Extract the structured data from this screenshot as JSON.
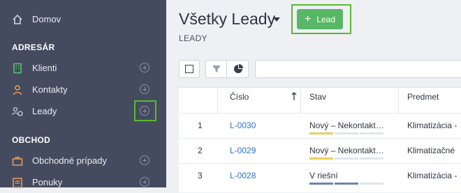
{
  "sidebar": {
    "home": {
      "label": "Domov",
      "icon": "home-icon"
    },
    "sections": [
      {
        "title": "ADRESÁR",
        "items": [
          {
            "label": "Klienti",
            "icon": "building-icon"
          },
          {
            "label": "Kontakty",
            "icon": "person-icon"
          },
          {
            "label": "Leady",
            "icon": "leads-icon"
          }
        ]
      },
      {
        "title": "OBCHOD",
        "items": [
          {
            "label": "Obchodné prípady",
            "icon": "briefcase-icon"
          },
          {
            "label": "Ponuky",
            "icon": "document-icon"
          }
        ]
      }
    ],
    "colors": {
      "background": "#444b5e",
      "highlight": "#5aba2d"
    }
  },
  "header": {
    "title": "Všetky Leady",
    "subtitle": "LEADY",
    "add_button": "Lead"
  },
  "table": {
    "columns": [
      "Číslo",
      "Stav",
      "Predmet"
    ],
    "rows": [
      {
        "index": "1",
        "number": "L-0030",
        "status": "Nový – Nekontakt…",
        "subject": "Klimatizácia -",
        "status_color": "#e9cf5c"
      },
      {
        "index": "2",
        "number": "L-0029",
        "status": "Nový – Nekontakt…",
        "subject": "Klimatizačné",
        "status_color": "#e9cf5c"
      },
      {
        "index": "3",
        "number": "L-0028",
        "status": "V riešní",
        "subject": "Klimatizácia -",
        "status_color": "#6a86b0"
      }
    ]
  },
  "colors": {
    "accent_green": "#58b766",
    "link_blue": "#2a73c8"
  }
}
